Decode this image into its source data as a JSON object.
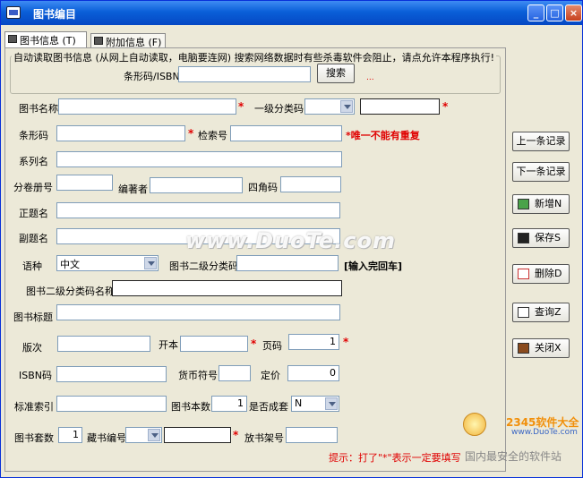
{
  "window": {
    "title": "图书编目",
    "minimize": "_",
    "maximize": "□",
    "close": "×"
  },
  "tabs": [
    {
      "label": "图书信息 (T)"
    },
    {
      "label": "附加信息 (F)"
    }
  ],
  "auto_read": {
    "legend": "自动读取图书信息 (从网上自动读取，电脑要连网) 搜索网络数据时有些杀毒软件会阻止，请点允许本程序执行!",
    "barcode_isbn_label": "条形码/ISBN",
    "barcode_isbn_value": "",
    "search_button": "搜索",
    "status": "..."
  },
  "form": {
    "book_name_label": "图书名称",
    "book_name_value": "",
    "level1_class_label": "一级分类码",
    "level1_class_value": "",
    "level1_text_value": "",
    "barcode_label": "条形码",
    "barcode_value": "",
    "index_no_label": "检索号",
    "index_no_value": "",
    "unique_note": "*唯一不能有重复",
    "series_label": "系列名",
    "series_value": "",
    "volume_label": "分卷册号",
    "volume_value": "",
    "author_label": "编著者",
    "author_value": "",
    "four_corner_label": "四角码",
    "four_corner_value": "",
    "main_title_label": "正题名",
    "main_title_value": "",
    "sub_title_label": "副题名",
    "sub_title_value": "",
    "language_label": "语种",
    "language_value": "中文",
    "level2_class_label": "图书二级分类码",
    "level2_class_value": "",
    "enter_hint": "[输入完回车]",
    "level2_name_label": "图书二级分类码名称",
    "level2_name_value": "",
    "subject_label": "图书标题",
    "subject_value": "",
    "edition_label": "版次",
    "edition_value": "",
    "format_label": "开本",
    "format_value": "",
    "pages_label": "页码",
    "pages_value": "1",
    "isbn_label": "ISBN码",
    "isbn_value": "",
    "currency_label": "货币符号",
    "currency_value": "",
    "price_label": "定价",
    "price_value": "0",
    "std_index_label": "标准索引",
    "std_index_value": "",
    "book_count_label": "图书本数",
    "book_count_value": "1",
    "is_set_label": "是否成套",
    "is_set_value": "N",
    "set_count_label": "图书套数",
    "set_count_value": "1",
    "collection_no_label": "藏书编号",
    "collection_no_value": "",
    "collection_text_value": "",
    "shelf_label": "放书架号",
    "shelf_value": "",
    "required_hint": "提示：打了\"*\"表示一定要填写",
    "star": "*"
  },
  "side_buttons": [
    {
      "label": "上一条记录",
      "icon": "none"
    },
    {
      "label": "下一条记录",
      "icon": "none"
    },
    {
      "label": "新增N",
      "icon": "add-icon"
    },
    {
      "label": "保存S",
      "icon": "save-icon"
    },
    {
      "label": "删除D",
      "icon": "delete-icon"
    },
    {
      "label": "查询Z",
      "icon": "query-icon"
    },
    {
      "label": "关闭X",
      "icon": "close-door-icon"
    }
  ],
  "watermark": {
    "text": "www.DuoTe.com"
  },
  "logo": {
    "brand": "2345软件大全",
    "url": "www.DuoTe.com",
    "slogan": "国内最安全的软件站"
  },
  "colors": {
    "title_bar": "#0a5fd8",
    "required": "#e00000",
    "window_bg": "#ece9d8"
  }
}
